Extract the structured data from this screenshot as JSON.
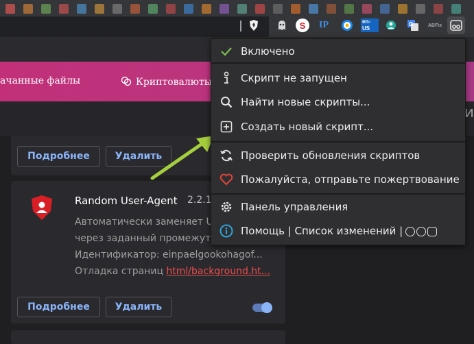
{
  "colors": {
    "accent_pink": "#c2307a",
    "menu_bg": "#2f2f32",
    "check_green": "#7fbf4d",
    "heart_red": "#e0443a",
    "link_red": "#ee4d4d",
    "button_text": "#8ab4f8",
    "info_blue": "#2fa3d8",
    "arrow_green": "#a6cf3e"
  },
  "toolbar": {
    "extensions": [
      {
        "icon": "brave-shield-icon",
        "text": ""
      },
      {
        "icon": "ghostery-icon",
        "text": ""
      },
      {
        "icon": "s-badge-icon",
        "text": "S"
      },
      {
        "icon": "ip-icon",
        "text": "IP"
      },
      {
        "icon": "vpn-icon",
        "text": ""
      },
      {
        "icon": "language-icon",
        "text": "en-US"
      },
      {
        "icon": "pinned-ext-icon",
        "text": ""
      },
      {
        "icon": "translate-icon",
        "text": ""
      },
      {
        "icon": "abfix-icon",
        "text": "ABFix"
      },
      {
        "icon": "tampermonkey-icon",
        "text": ""
      }
    ]
  },
  "page": {
    "pink_tabs": [
      "ачанные файлы",
      "Криптовалюты"
    ],
    "right_glyph": "ни"
  },
  "cards": {
    "top": {
      "details_label": "Подробнее",
      "delete_label": "Удалить"
    },
    "extension": {
      "title": "Random User-Agent",
      "version": "2.2.1",
      "desc_line1": "Автоматически заменяет U",
      "desc_line2": "через заданный промежут",
      "id_line": "Идентификатор: einpaelgookohagof...",
      "debug_prefix": "Отладка страниц",
      "debug_link": "html/background.ht...",
      "details_label": "Подробнее",
      "delete_label": "Удалить",
      "enabled": true
    }
  },
  "menu": {
    "enabled_label": "Включено",
    "not_running_label": "Скрипт не запущен",
    "find_label": "Найти новые скрипты...",
    "create_label": "Создать новый скрипт...",
    "check_updates_label": "Проверить обновления скриптов",
    "donate_label": "Пожалуйста, отправьте пожертвование",
    "dashboard_label": "Панель управления",
    "help_label": "Помощь | Список изменений |"
  }
}
